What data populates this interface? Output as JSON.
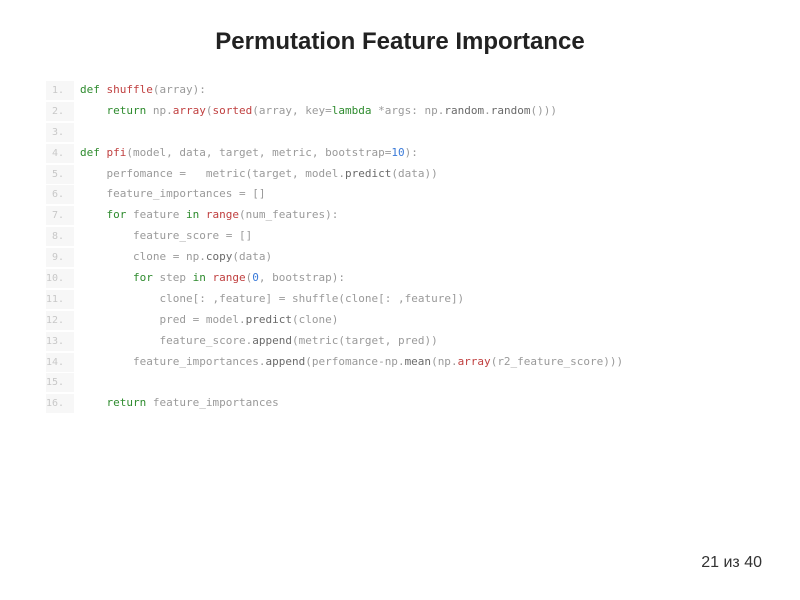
{
  "title": "Permutation Feature Importance",
  "footer": {
    "page_current": "21",
    "page_sep": " из ",
    "page_total": "40"
  },
  "code": {
    "lines": [
      {
        "n": "1.",
        "tokens": [
          [
            "kw",
            "def "
          ],
          [
            "fn",
            "shuffle"
          ],
          [
            "op",
            "("
          ],
          [
            "id",
            "array"
          ],
          [
            "op",
            "):"
          ]
        ]
      },
      {
        "n": "2.",
        "tokens": [
          [
            "op",
            "    "
          ],
          [
            "kw",
            "return "
          ],
          [
            "id",
            "np"
          ],
          [
            "op",
            "."
          ],
          [
            "fn",
            "array"
          ],
          [
            "op",
            "("
          ],
          [
            "fn",
            "sorted"
          ],
          [
            "op",
            "("
          ],
          [
            "id",
            "array"
          ],
          [
            "op",
            ", "
          ],
          [
            "id",
            "key"
          ],
          [
            "op",
            "="
          ],
          [
            "kw",
            "lambda"
          ],
          [
            "op",
            " *"
          ],
          [
            "id",
            "args"
          ],
          [
            "op",
            ": "
          ],
          [
            "id",
            "np"
          ],
          [
            "op",
            "."
          ],
          [
            "call",
            "random"
          ],
          [
            "op",
            "."
          ],
          [
            "call",
            "random"
          ],
          [
            "op",
            "()))"
          ]
        ]
      },
      {
        "n": "3.",
        "tokens": [
          [
            "op",
            " "
          ]
        ]
      },
      {
        "n": "4.",
        "tokens": [
          [
            "kw",
            "def "
          ],
          [
            "fn",
            "pfi"
          ],
          [
            "op",
            "("
          ],
          [
            "id",
            "model"
          ],
          [
            "op",
            ", "
          ],
          [
            "id",
            "data"
          ],
          [
            "op",
            ", "
          ],
          [
            "id",
            "target"
          ],
          [
            "op",
            ", "
          ],
          [
            "id",
            "metric"
          ],
          [
            "op",
            ", "
          ],
          [
            "id",
            "bootstrap"
          ],
          [
            "op",
            "="
          ],
          [
            "num",
            "10"
          ],
          [
            "op",
            "):"
          ]
        ]
      },
      {
        "n": "5.",
        "tokens": [
          [
            "op",
            "    "
          ],
          [
            "id",
            "perfomance"
          ],
          [
            "op",
            " =   "
          ],
          [
            "id",
            "metric"
          ],
          [
            "op",
            "("
          ],
          [
            "id",
            "target"
          ],
          [
            "op",
            ", "
          ],
          [
            "id",
            "model"
          ],
          [
            "op",
            "."
          ],
          [
            "call",
            "predict"
          ],
          [
            "op",
            "("
          ],
          [
            "id",
            "data"
          ],
          [
            "op",
            "))"
          ]
        ]
      },
      {
        "n": "6.",
        "tokens": [
          [
            "op",
            "    "
          ],
          [
            "id",
            "feature_importances"
          ],
          [
            "op",
            " = []"
          ]
        ]
      },
      {
        "n": "7.",
        "tokens": [
          [
            "op",
            "    "
          ],
          [
            "kw",
            "for "
          ],
          [
            "id",
            "feature"
          ],
          [
            "kw",
            " in "
          ],
          [
            "fn",
            "range"
          ],
          [
            "op",
            "("
          ],
          [
            "id",
            "num_features"
          ],
          [
            "op",
            "):"
          ]
        ]
      },
      {
        "n": "8.",
        "tokens": [
          [
            "op",
            "        "
          ],
          [
            "id",
            "feature_score"
          ],
          [
            "op",
            " = []"
          ]
        ]
      },
      {
        "n": "9.",
        "tokens": [
          [
            "op",
            "        "
          ],
          [
            "id",
            "clone"
          ],
          [
            "op",
            " = "
          ],
          [
            "id",
            "np"
          ],
          [
            "op",
            "."
          ],
          [
            "call",
            "copy"
          ],
          [
            "op",
            "("
          ],
          [
            "id",
            "data"
          ],
          [
            "op",
            ")"
          ]
        ]
      },
      {
        "n": "10.",
        "tokens": [
          [
            "op",
            "        "
          ],
          [
            "kw",
            "for "
          ],
          [
            "id",
            "step"
          ],
          [
            "kw",
            " in "
          ],
          [
            "fn",
            "range"
          ],
          [
            "op",
            "("
          ],
          [
            "num",
            "0"
          ],
          [
            "op",
            ", "
          ],
          [
            "id",
            "bootstrap"
          ],
          [
            "op",
            "):"
          ]
        ]
      },
      {
        "n": "11.",
        "tokens": [
          [
            "op",
            "            "
          ],
          [
            "id",
            "clone"
          ],
          [
            "op",
            "[: ,"
          ],
          [
            "id",
            "feature"
          ],
          [
            "op",
            "] = "
          ],
          [
            "id",
            "shuffle"
          ],
          [
            "op",
            "("
          ],
          [
            "id",
            "clone"
          ],
          [
            "op",
            "[: ,"
          ],
          [
            "id",
            "feature"
          ],
          [
            "op",
            "])"
          ]
        ]
      },
      {
        "n": "12.",
        "tokens": [
          [
            "op",
            "            "
          ],
          [
            "id",
            "pred"
          ],
          [
            "op",
            " = "
          ],
          [
            "id",
            "model"
          ],
          [
            "op",
            "."
          ],
          [
            "call",
            "predict"
          ],
          [
            "op",
            "("
          ],
          [
            "id",
            "clone"
          ],
          [
            "op",
            ")"
          ]
        ]
      },
      {
        "n": "13.",
        "tokens": [
          [
            "op",
            "            "
          ],
          [
            "id",
            "feature_score"
          ],
          [
            "op",
            "."
          ],
          [
            "call",
            "append"
          ],
          [
            "op",
            "("
          ],
          [
            "id",
            "metric"
          ],
          [
            "op",
            "("
          ],
          [
            "id",
            "target"
          ],
          [
            "op",
            ", "
          ],
          [
            "id",
            "pred"
          ],
          [
            "op",
            "))"
          ]
        ]
      },
      {
        "n": "14.",
        "tokens": [
          [
            "op",
            "        "
          ],
          [
            "id",
            "feature_importances"
          ],
          [
            "op",
            "."
          ],
          [
            "call",
            "append"
          ],
          [
            "op",
            "("
          ],
          [
            "id",
            "perfomance"
          ],
          [
            "op",
            "-"
          ],
          [
            "id",
            "np"
          ],
          [
            "op",
            "."
          ],
          [
            "call",
            "mean"
          ],
          [
            "op",
            "("
          ],
          [
            "id",
            "np"
          ],
          [
            "op",
            "."
          ],
          [
            "fn",
            "array"
          ],
          [
            "op",
            "("
          ],
          [
            "id",
            "r2_feature_score"
          ],
          [
            "op",
            ")))"
          ]
        ]
      },
      {
        "n": "15.",
        "tokens": [
          [
            "op",
            " "
          ]
        ]
      },
      {
        "n": "16.",
        "tokens": [
          [
            "op",
            "    "
          ],
          [
            "kw",
            "return "
          ],
          [
            "id",
            "feature_importances"
          ]
        ]
      }
    ]
  }
}
